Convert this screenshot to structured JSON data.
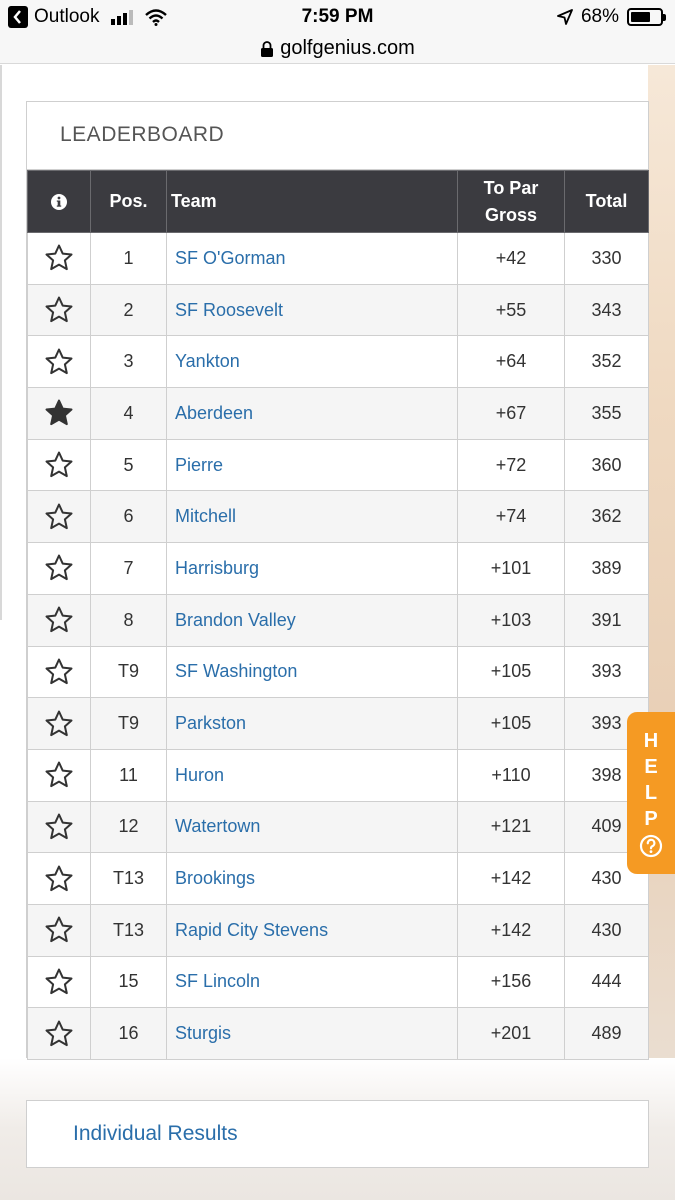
{
  "status_bar": {
    "back_app": "Outlook",
    "time": "7:59 PM",
    "battery": "68%",
    "battery_level": 0.68
  },
  "browser": {
    "url": "golfgenius.com"
  },
  "leaderboard": {
    "title": "LEADERBOARD",
    "columns": {
      "pos": "Pos.",
      "team": "Team",
      "to_par_line1": "To Par",
      "to_par_line2": "Gross",
      "total": "Total"
    },
    "rows": [
      {
        "pos": "1",
        "team": "SF O'Gorman",
        "to_par": "+42",
        "total": "330",
        "starred": false
      },
      {
        "pos": "2",
        "team": "SF Roosevelt",
        "to_par": "+55",
        "total": "343",
        "starred": false
      },
      {
        "pos": "3",
        "team": "Yankton",
        "to_par": "+64",
        "total": "352",
        "starred": false
      },
      {
        "pos": "4",
        "team": "Aberdeen",
        "to_par": "+67",
        "total": "355",
        "starred": true
      },
      {
        "pos": "5",
        "team": "Pierre",
        "to_par": "+72",
        "total": "360",
        "starred": false
      },
      {
        "pos": "6",
        "team": "Mitchell",
        "to_par": "+74",
        "total": "362",
        "starred": false
      },
      {
        "pos": "7",
        "team": "Harrisburg",
        "to_par": "+101",
        "total": "389",
        "starred": false
      },
      {
        "pos": "8",
        "team": "Brandon Valley",
        "to_par": "+103",
        "total": "391",
        "starred": false
      },
      {
        "pos": "T9",
        "team": "SF Washington",
        "to_par": "+105",
        "total": "393",
        "starred": false
      },
      {
        "pos": "T9",
        "team": "Parkston",
        "to_par": "+105",
        "total": "393",
        "starred": false
      },
      {
        "pos": "11",
        "team": "Huron",
        "to_par": "+110",
        "total": "398",
        "starred": false
      },
      {
        "pos": "12",
        "team": "Watertown",
        "to_par": "+121",
        "total": "409",
        "starred": false
      },
      {
        "pos": "T13",
        "team": "Brookings",
        "to_par": "+142",
        "total": "430",
        "starred": false
      },
      {
        "pos": "T13",
        "team": "Rapid City Stevens",
        "to_par": "+142",
        "total": "430",
        "starred": false
      },
      {
        "pos": "15",
        "team": "SF Lincoln",
        "to_par": "+156",
        "total": "444",
        "starred": false
      },
      {
        "pos": "16",
        "team": "Sturgis",
        "to_par": "+201",
        "total": "489",
        "starred": false
      }
    ]
  },
  "help": {
    "letters": [
      "H",
      "E",
      "L",
      "P"
    ]
  },
  "individual_results": {
    "label": "Individual Results"
  },
  "colors": {
    "header_bg": "#3b3b40",
    "link": "#2a6eaa",
    "help": "#f59a23"
  },
  "icons": {
    "star_empty": "star-outline-icon",
    "star_filled": "star-filled-icon",
    "info": "info-icon",
    "help": "question-circle-icon"
  }
}
